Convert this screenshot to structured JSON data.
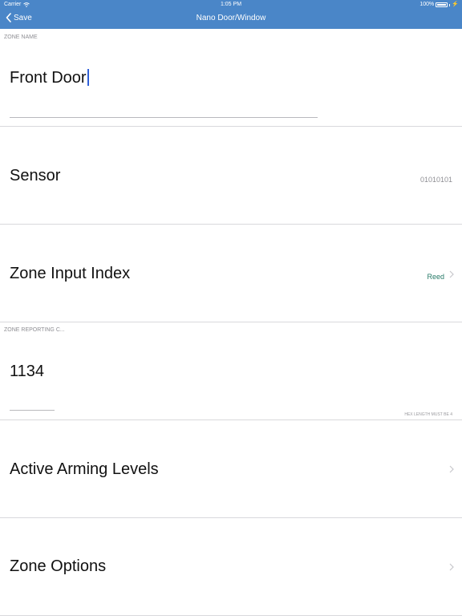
{
  "status_bar": {
    "carrier": "Carrier",
    "time": "1:05 PM",
    "battery": "100%"
  },
  "nav": {
    "back_label": "Save",
    "title": "Nano Door/Window"
  },
  "sections": {
    "zone_name_header": "ZONE NAME",
    "zone_reporting_header": "ZONE REPORTING C..."
  },
  "zone_name": {
    "value": "Front Door"
  },
  "sensor": {
    "label": "Sensor",
    "value": "01010101"
  },
  "zone_input_index": {
    "label": "Zone Input Index",
    "value": "Reed"
  },
  "zone_reporting": {
    "value": "1134",
    "hint": "HEX LENGTH MUST BE 4"
  },
  "active_arming_levels": {
    "label": "Active Arming Levels"
  },
  "zone_options": {
    "label": "Zone Options"
  },
  "colors": {
    "nav_bar": "#4a86c8",
    "accent": "#267a67",
    "caret": "#2f5fd8"
  },
  "icons": {
    "back": "chevron-left-icon",
    "disclosure": "chevron-right-icon",
    "wifi": "wifi-icon",
    "battery": "battery-icon"
  }
}
